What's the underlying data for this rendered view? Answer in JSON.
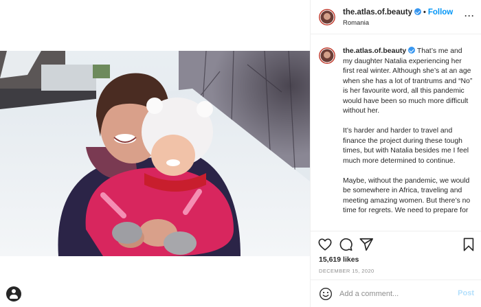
{
  "post": {
    "username": "the.atlas.of.beauty",
    "follow_label": "Follow",
    "separator": "•",
    "location": "Romania",
    "more_label": "···",
    "caption_paragraphs": [
      "That’s me and my daughter Natalia experiencing her first real winter. Although she’s at an age when she has a lot of trantrums and “No” is her favourite word, all this pandemic would have been so much more difficult without her.",
      "It’s harder and harder to travel and finance the project during these tough times, but with Natalia besides me I feel much more determined to continue.",
      "Maybe, without the pandemic, we would be somewhere in Africa, traveling and meeting amazing women. But there’s no time for regrets. We need to prepare for"
    ],
    "likes": "15,619 likes",
    "date": "DECEMBER 15, 2020"
  },
  "comment": {
    "placeholder": "Add a comment...",
    "post_label": "Post"
  },
  "icons": {
    "like": "heart-icon",
    "comment": "comment-icon",
    "share": "share-icon",
    "save": "bookmark-icon",
    "emoji": "emoji-icon",
    "profile": "profile-icon",
    "verified": "verified-badge-icon",
    "more": "more-options-icon"
  },
  "colors": {
    "link_blue": "#0095f6",
    "verified_blue": "#3897f0",
    "post_disabled": "#b2dffc",
    "text": "#262626",
    "muted": "#8e8e8e"
  }
}
